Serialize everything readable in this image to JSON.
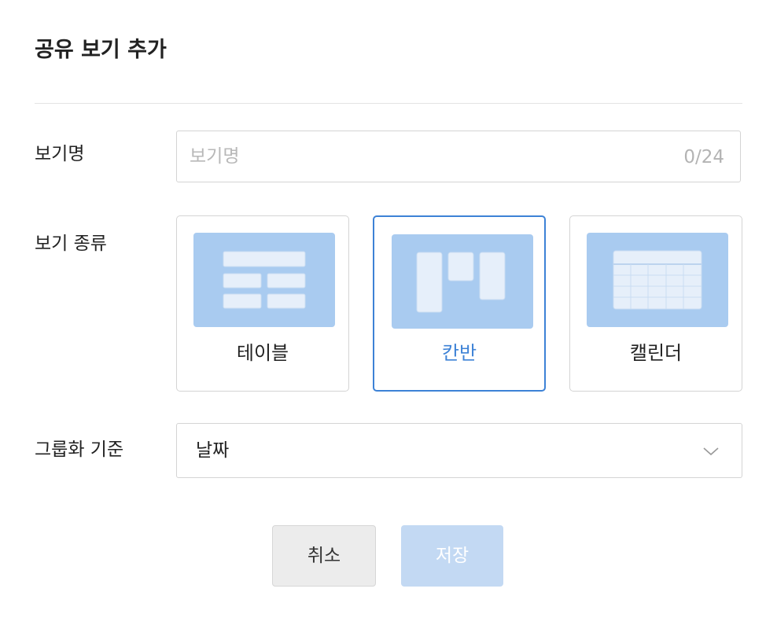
{
  "dialog": {
    "title": "공유 보기 추가"
  },
  "view_name": {
    "label": "보기명",
    "value": "",
    "placeholder": "보기명",
    "counter": "0/24"
  },
  "view_type": {
    "label": "보기 종류",
    "options": [
      {
        "label": "테이블",
        "icon": "table-view-icon",
        "selected": false
      },
      {
        "label": "칸반",
        "icon": "kanban-view-icon",
        "selected": true
      },
      {
        "label": "캘린더",
        "icon": "calendar-view-icon",
        "selected": false
      }
    ]
  },
  "group_by": {
    "label": "그룹화 기준",
    "value": "날짜",
    "icon": "chevron-down-icon"
  },
  "actions": {
    "cancel_label": "취소",
    "save_label": "저장"
  },
  "colors": {
    "accent": "#3d82d6",
    "thumb_bg": "#a9cbf0",
    "save_disabled_bg": "#c3d9f3",
    "cancel_bg": "#ececec"
  }
}
